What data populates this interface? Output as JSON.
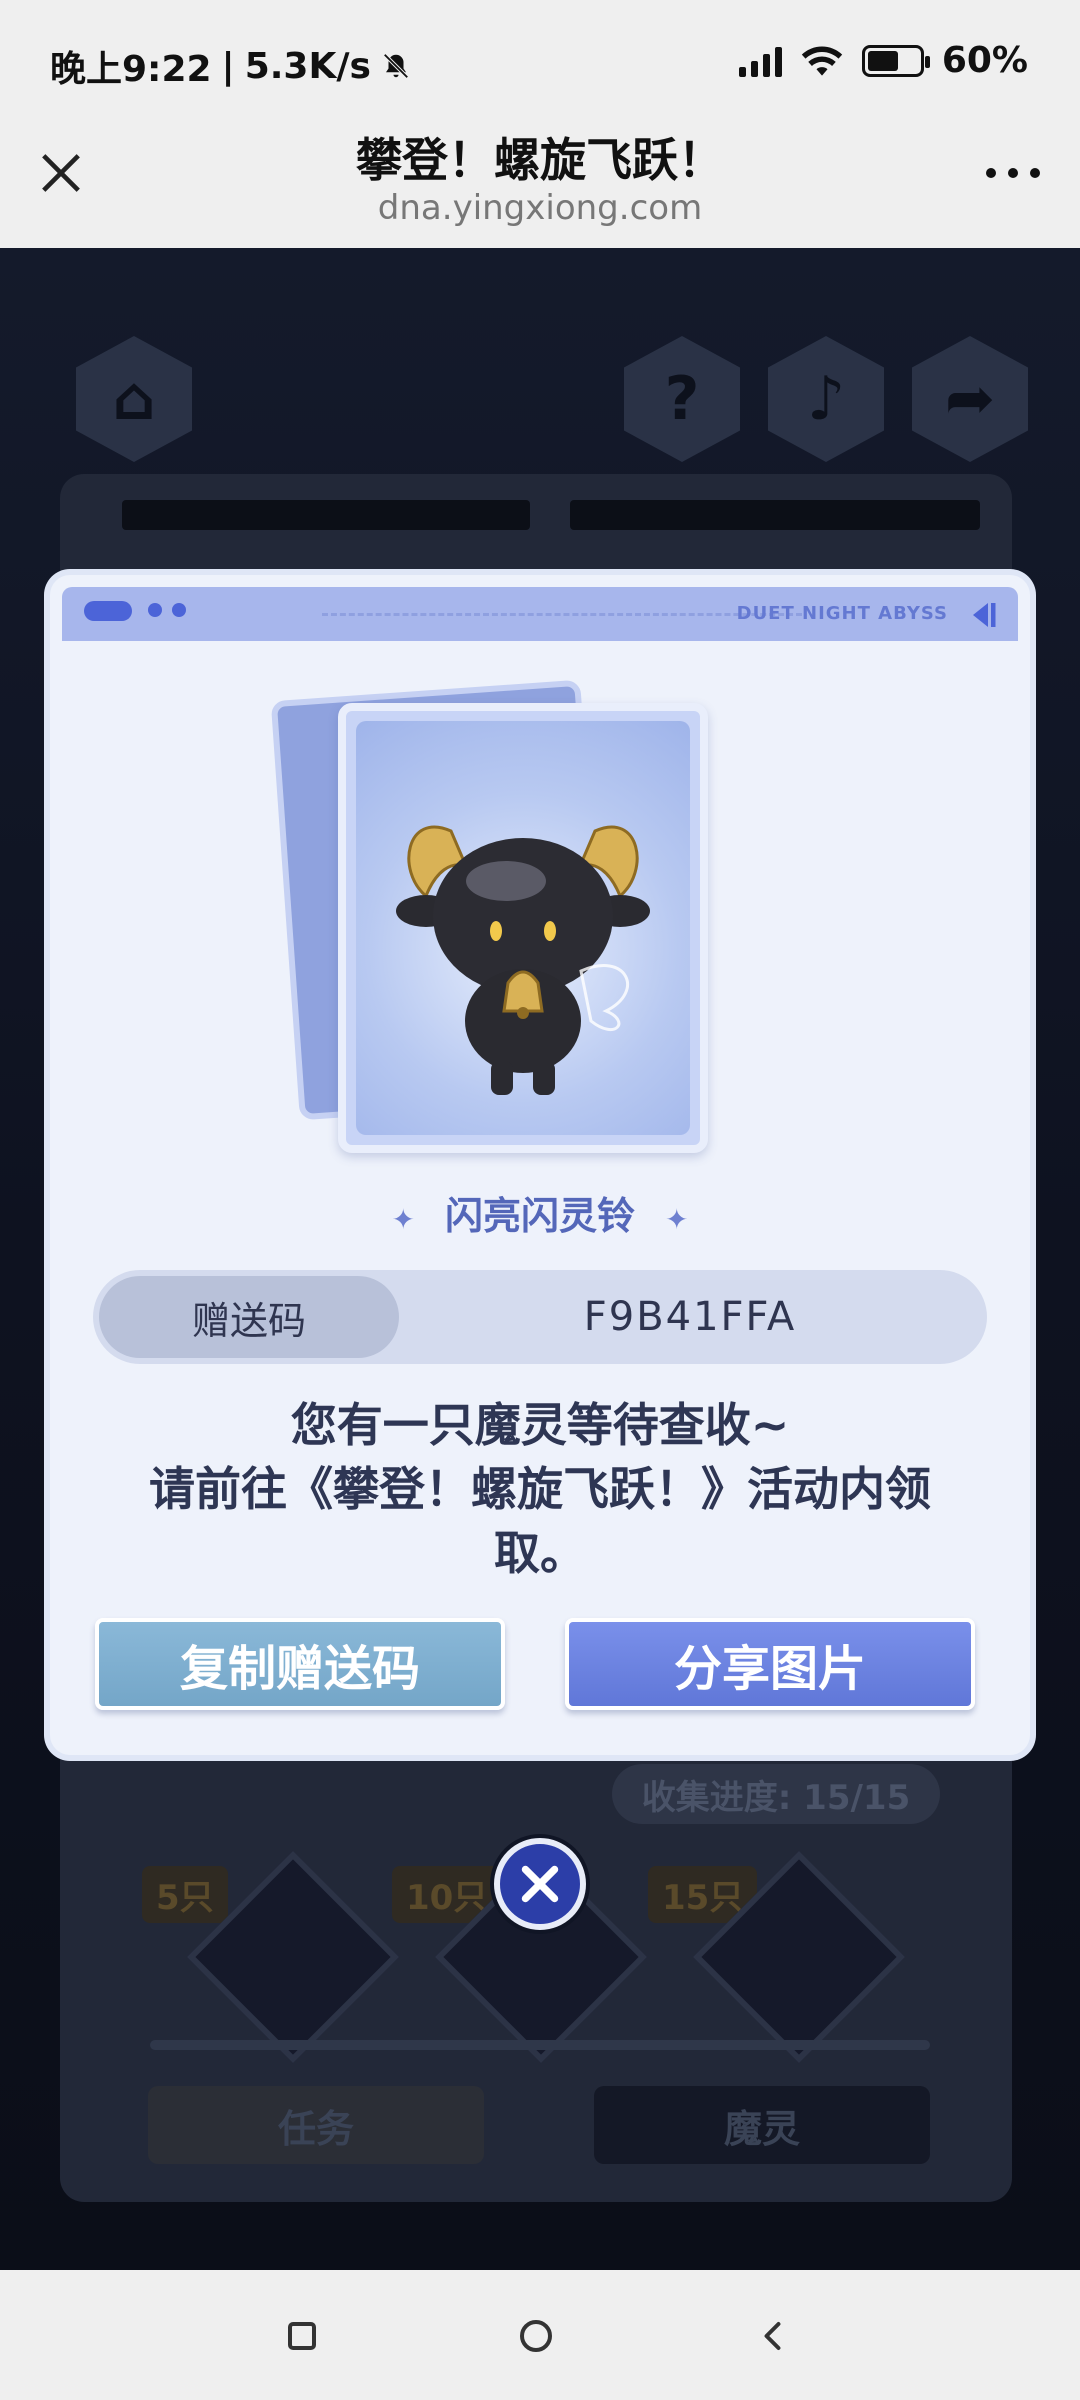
{
  "status_bar": {
    "time": "晚上9:22",
    "speed": "5.3K/s",
    "battery": "60%"
  },
  "browser": {
    "title": "攀登！螺旋飞跃！",
    "url": "dna.yingxiong.com"
  },
  "background": {
    "progress_text": "收集进度: 15/15",
    "tiers": [
      "5只",
      "10只",
      "15只"
    ],
    "tabs": [
      "任务",
      "魔灵"
    ]
  },
  "modal": {
    "brand_text": "DUET NIGHT ABYSS",
    "item_name": "闪亮闪灵铃",
    "code_label": "赠送码",
    "code_value": "F9B41FFA",
    "message_line1": "您有一只魔灵等待查收~",
    "message_line2": "请前往《攀登！螺旋飞跃！》活动内领",
    "message_line3": "取。",
    "copy_button": "复制赠送码",
    "share_button": "分享图片"
  },
  "colors": {
    "modal_bg": "#eef2fb",
    "accent": "#6077d8",
    "copy_button": "#74a6c8",
    "dark_bg": "#0c0f1a"
  }
}
